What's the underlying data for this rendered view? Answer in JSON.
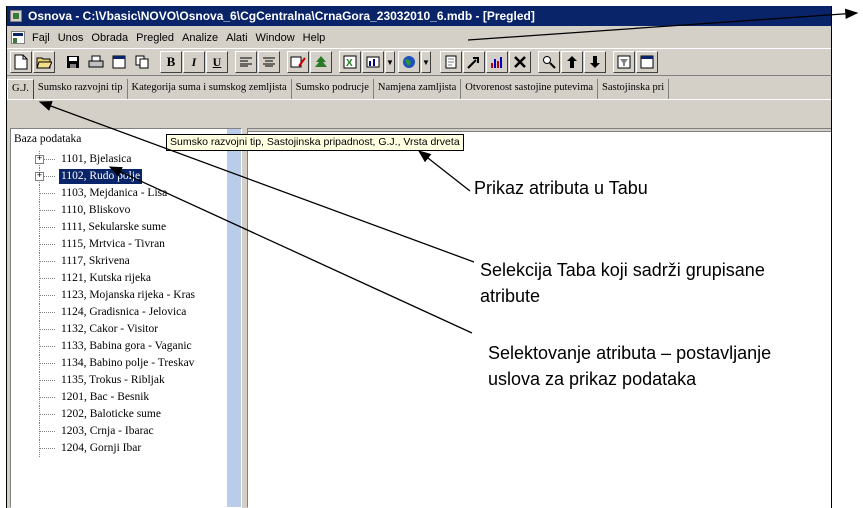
{
  "window": {
    "title": "Osnova - C:\\Vbasic\\NOVO\\Osnova_6\\CgCentralna\\CrnaGora_23032010_6.mdb - [Pregled]"
  },
  "menu": {
    "items": [
      "Fajl",
      "Unos",
      "Obrada",
      "Pregled",
      "Analize",
      "Alati",
      "Window",
      "Help"
    ]
  },
  "toolbar": {
    "bold_label": "B",
    "italic_label": "I",
    "underline_label": "U"
  },
  "tabs": [
    "G.J.",
    "Sumsko razvojni tip",
    "Kategorija suma i sumskog zemljista",
    "Sumsko podrucje",
    "Namjena zamljista",
    "Otvorenost sastojine putevima",
    "Sastojinska pri"
  ],
  "tree": {
    "root": "Baza podataka",
    "items": [
      {
        "label": "1101, Bjelasica",
        "expandable": true,
        "selected": false
      },
      {
        "label": "1102, Rudo polje",
        "expandable": true,
        "selected": true
      },
      {
        "label": "1103, Mejdanica - Lisa",
        "expandable": false,
        "selected": false
      },
      {
        "label": "1110, Bliskovo",
        "expandable": false,
        "selected": false
      },
      {
        "label": "1111, Sekularske sume",
        "expandable": false,
        "selected": false
      },
      {
        "label": "1115, Mrtvica - Tivran",
        "expandable": false,
        "selected": false
      },
      {
        "label": "1117, Skrivena",
        "expandable": false,
        "selected": false
      },
      {
        "label": "1121, Kutska rijeka",
        "expandable": false,
        "selected": false
      },
      {
        "label": "1123, Mojanska rijeka - Kras",
        "expandable": false,
        "selected": false
      },
      {
        "label": "1124, Gradisnica - Jelovica",
        "expandable": false,
        "selected": false
      },
      {
        "label": "1132, Cakor - Visitor",
        "expandable": false,
        "selected": false
      },
      {
        "label": "1133, Babina gora - Vaganic",
        "expandable": false,
        "selected": false
      },
      {
        "label": "1134, Babino polje - Treskav",
        "expandable": false,
        "selected": false
      },
      {
        "label": "1135, Trokus - Ribljak",
        "expandable": false,
        "selected": false
      },
      {
        "label": "1201, Bac - Besnik",
        "expandable": false,
        "selected": false
      },
      {
        "label": "1202, Baloticke sume",
        "expandable": false,
        "selected": false
      },
      {
        "label": "1203, Crnja - Ibarac",
        "expandable": false,
        "selected": false
      },
      {
        "label": "1204, Gornji Ibar",
        "expandable": false,
        "selected": false
      }
    ]
  },
  "tooltip": {
    "text": "Sumsko razvojni tip, Sastojinska pripadnost, G.J., Vrsta drveta"
  },
  "annotations": {
    "tab_display": "Prikaz atributa u Tabu",
    "tab_selection": "Selekcija Taba koji sadrži grupisane atribute",
    "attribute_selection": "Selektovanje atributa – postavljanje uslova za prikaz podataka"
  },
  "colors": {
    "titlebar": "#0a246a",
    "selection": "#0a246a",
    "window_bg": "#d4d0c8",
    "tooltip_bg": "#ffffe1",
    "scrollbar": "#b9cdea"
  }
}
